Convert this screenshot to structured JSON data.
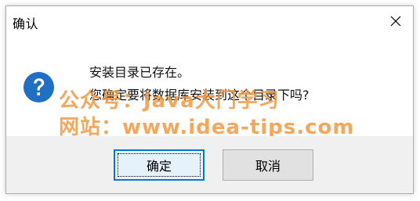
{
  "dialog": {
    "title": "确认",
    "message_line1": "安装目录已存在。",
    "message_line2": "您确定要将数据库安装到这个目录下吗?",
    "icon": "question-icon",
    "ok_label": "确定",
    "cancel_label": "取消"
  },
  "watermark": {
    "line1": "公众号：Java大门学习",
    "line2": "网站：www.idea-tips.com",
    "color": "#f6983e"
  },
  "colors": {
    "accent": "#0078d7",
    "icon_blue": "#1f6fc5",
    "footer_bg": "#f0f0f0"
  }
}
